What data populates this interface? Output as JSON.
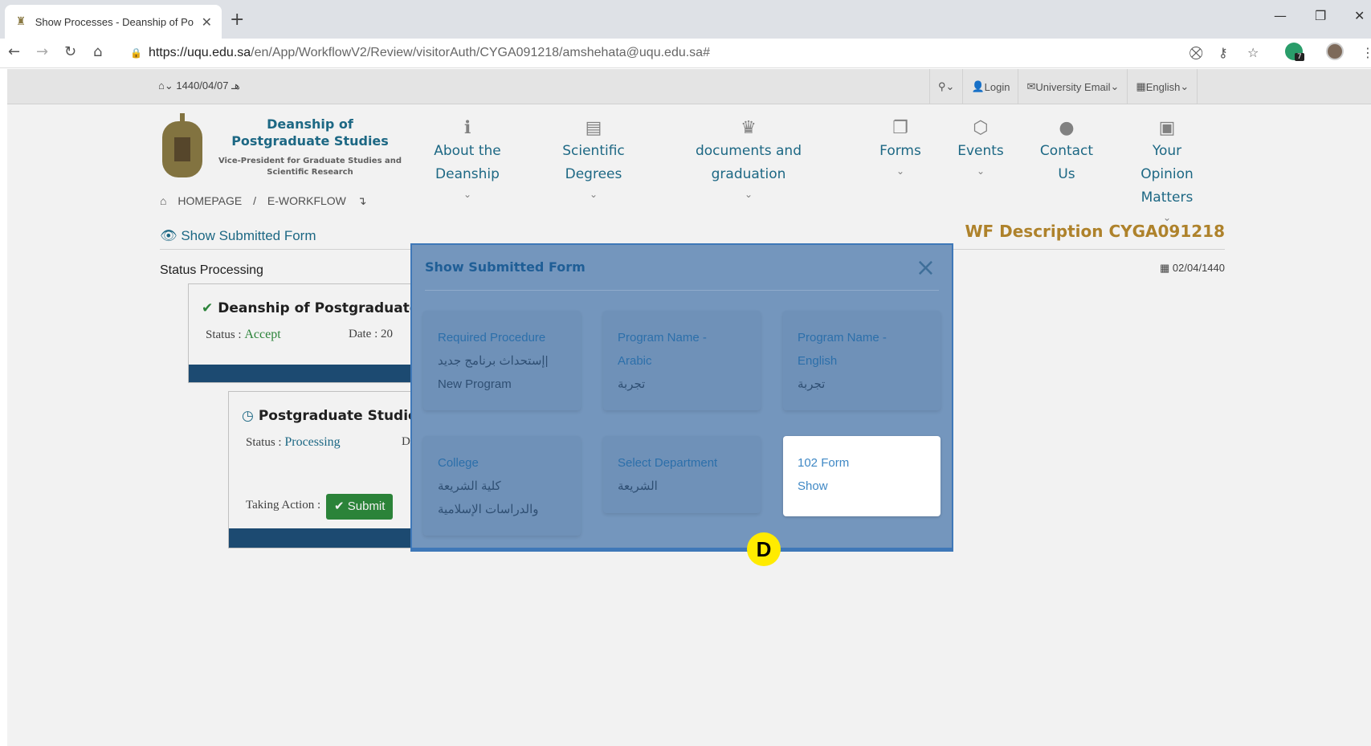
{
  "browser": {
    "tab_title": "Show Processes - Deanship of Po",
    "url_host": "https://uqu.edu.sa",
    "url_path": "/en/App/WorkflowV2/Review/visitorAuth/CYGA091218/amshehata@uqu.edu.sa#",
    "extension_count": "7"
  },
  "topbar": {
    "date": "1440/04/07 هـ",
    "login": "Login",
    "email": "University Email",
    "language": "English"
  },
  "brand": {
    "title": "Deanship of Postgraduate Studies",
    "subtitle": "Vice-President for Graduate Studies and Scientific Research"
  },
  "nav": [
    {
      "label": "About the Deanship",
      "icon": "info-icon"
    },
    {
      "label": "Scientific Degrees",
      "icon": "book-icon"
    },
    {
      "label": "documents and graduation",
      "icon": "trophy-icon"
    },
    {
      "label": "Forms",
      "icon": "copy-icon"
    },
    {
      "label": "Events",
      "icon": "events-icon"
    },
    {
      "label": "Contact Us",
      "icon": "android-icon"
    },
    {
      "label": "Your Opinion Matters",
      "icon": "clipboard-icon"
    }
  ],
  "breadcrumb": {
    "home": "HOMEPAGE",
    "separator": "/",
    "current": "E-WORKFLOW"
  },
  "page": {
    "show_submitted": "Show Submitted Form",
    "wf_description": "WF Description CYGA091218",
    "status_line": "Status Processing",
    "calendar_date": "02/04/1440"
  },
  "cards": [
    {
      "title": "Deanship of Postgraduate S",
      "status_label": "Status :",
      "status_value": "Accept",
      "date_label": "Date : 20"
    },
    {
      "title": "Postgraduate Studies",
      "status_label": "Status :",
      "status_value": "Processing",
      "date_label": "D",
      "action_label": "Taking Action :",
      "submit_label": "Submit"
    }
  ],
  "modal": {
    "title": "Show Submitted Form",
    "close_glyph": "×",
    "fields": [
      {
        "label": "Required Procedure",
        "value": "إستحداث برنامج جديد|",
        "value2": "New Program"
      },
      {
        "label": "Program Name -",
        "label2": "Arabic",
        "value": "تجربة"
      },
      {
        "label": "Program Name -",
        "label2": "English",
        "value": "تجربة"
      },
      {
        "label": "College",
        "value": "كلية الشريعة",
        "value2": "والدراسات الإسلامية"
      },
      {
        "label": "Select Department",
        "value": "الشريعة"
      },
      {
        "label": "102 Form",
        "value": "Show"
      }
    ]
  },
  "marker": "D"
}
